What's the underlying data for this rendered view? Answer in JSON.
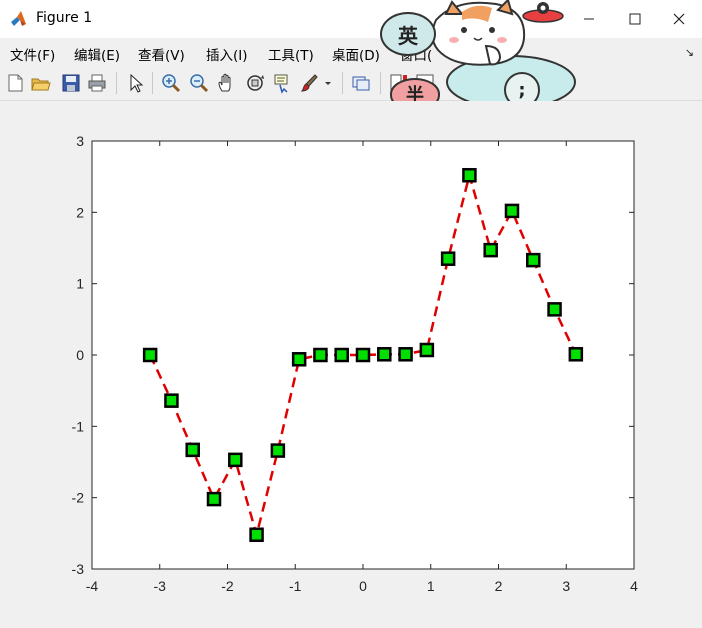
{
  "window": {
    "title": "Figure 1",
    "minimize_icon": "minimize-icon",
    "maximize_icon": "maximize-icon",
    "close_icon": "close-icon"
  },
  "menu": {
    "items": [
      "文件(F)",
      "编辑(E)",
      "查看(V)",
      "插入(I)",
      "工具(T)",
      "桌面(D)",
      "窗口("
    ]
  },
  "toolbar": {
    "icons": [
      "new-figure-icon",
      "open-icon",
      "save-icon",
      "print-icon",
      "pointer-icon",
      "zoom-in-icon",
      "zoom-out-icon",
      "pan-icon",
      "rotate-3d-icon",
      "data-cursor-icon",
      "brush-icon",
      "link-icon",
      "colorbar-icon",
      "legend-icon"
    ]
  },
  "overlay": {
    "badge_top": "英",
    "badge_bottom": "半",
    "badge_right": ";"
  },
  "chart_data": {
    "type": "line",
    "title": "",
    "xlabel": "",
    "ylabel": "",
    "xlim": [
      -4,
      4
    ],
    "ylim": [
      -3,
      3
    ],
    "xticks": [
      -4,
      -3,
      -2,
      -1,
      0,
      1,
      2,
      3,
      4
    ],
    "yticks": [
      -3,
      -2,
      -1,
      0,
      1,
      2,
      3
    ],
    "xtick_labels": [
      "-4",
      "-3",
      "-2",
      "-1",
      "0",
      "1",
      "2",
      "3",
      "4"
    ],
    "ytick_labels": [
      "-3",
      "-2",
      "-1",
      "0",
      "1",
      "2",
      "3"
    ],
    "grid": false,
    "line_color": "#e00000",
    "line_style": "dashed",
    "marker": "square",
    "marker_face_color": "#00e000",
    "marker_edge_color": "#000000",
    "series": [
      {
        "x": [
          -3.1416,
          -2.8274,
          -2.5133,
          -2.1991,
          -1.885,
          -1.5708,
          -1.2566,
          -0.9425,
          -0.6283,
          -0.3142,
          0,
          0.3142,
          0.6283,
          0.9425,
          1.2566,
          1.5708,
          1.885,
          2.1991,
          2.5133,
          2.8274,
          3.1416
        ],
        "y": [
          0,
          -0.64,
          -1.33,
          -2.02,
          -1.47,
          -2.52,
          -1.34,
          -0.06,
          0.0,
          0.0,
          0.0,
          0.01,
          0.01,
          0.07,
          1.35,
          2.52,
          1.47,
          2.02,
          1.33,
          0.64,
          0.01
        ]
      }
    ]
  }
}
